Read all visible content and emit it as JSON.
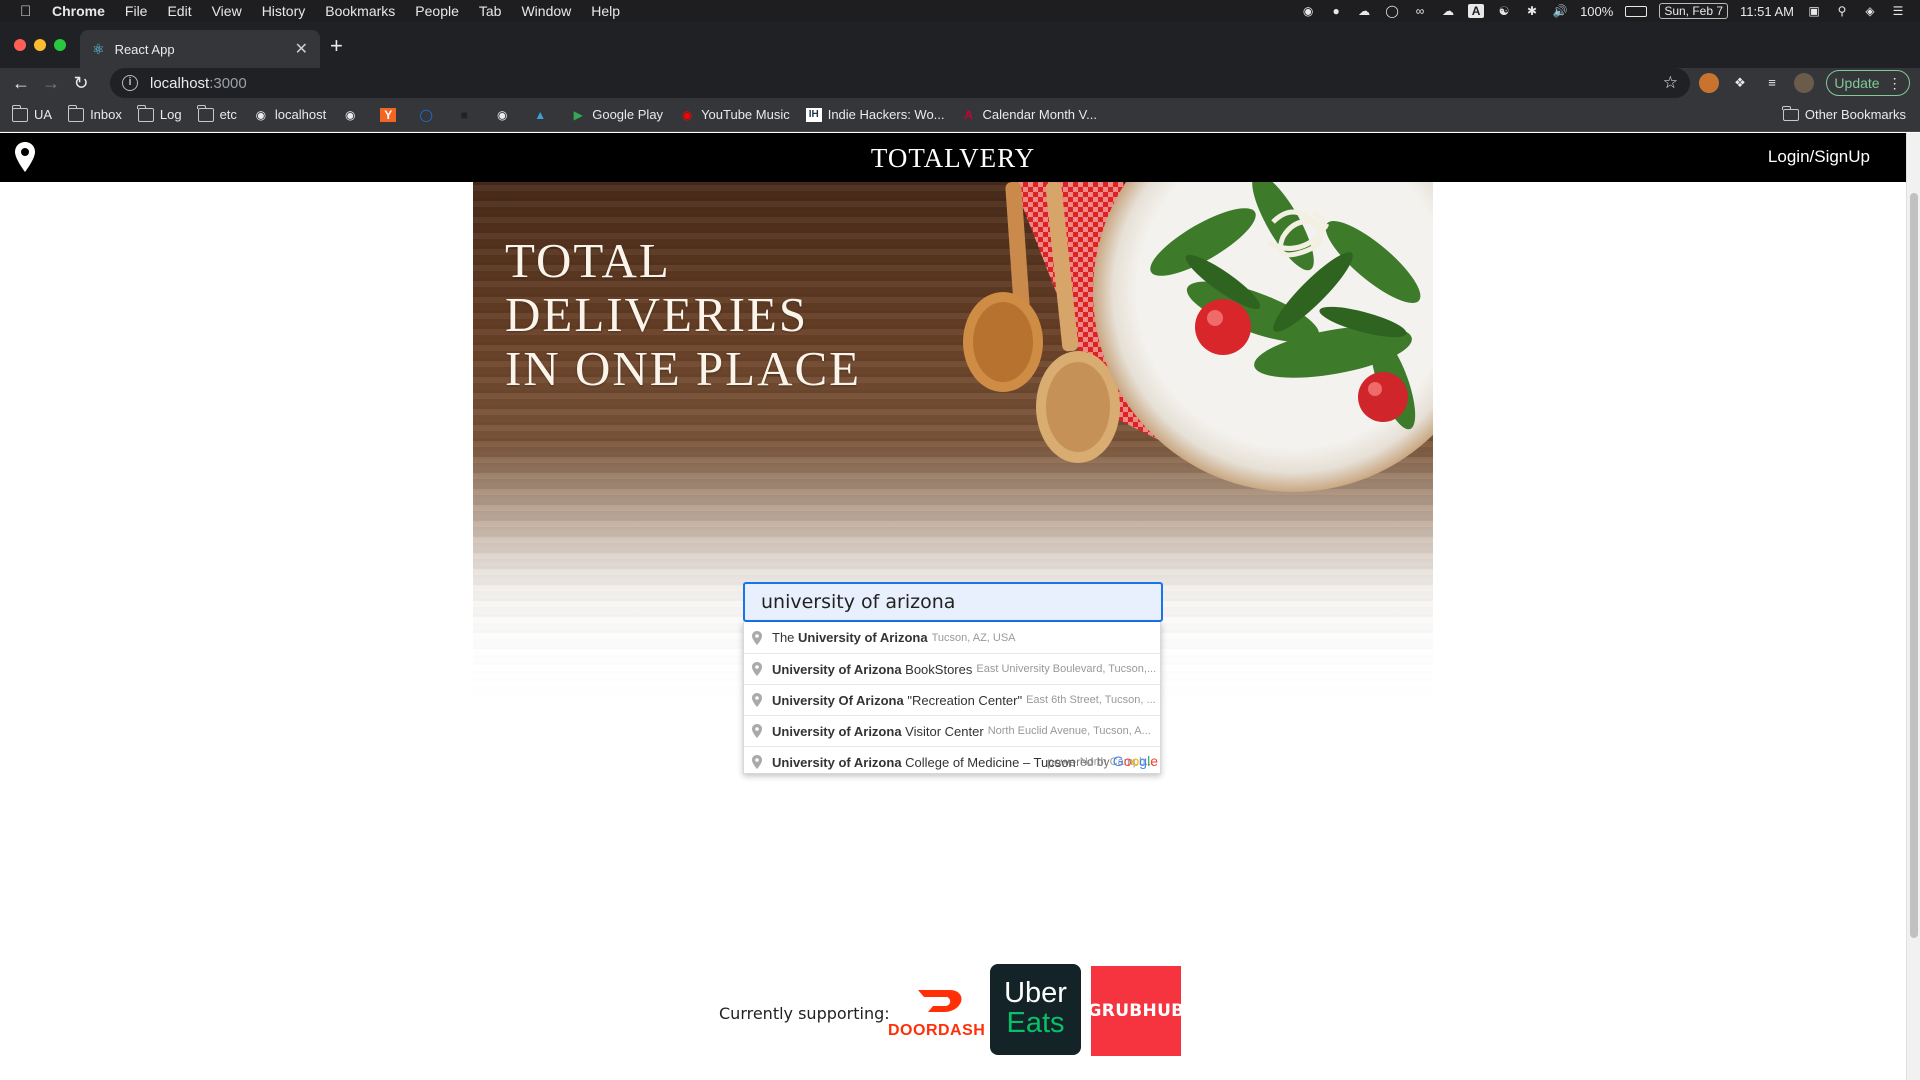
{
  "menubar": {
    "app": "Chrome",
    "items": [
      "File",
      "Edit",
      "View",
      "History",
      "Bookmarks",
      "People",
      "Tab",
      "Window",
      "Help"
    ],
    "battery": "100%",
    "date": "Sun, Feb 7",
    "time": "11:51 AM"
  },
  "tab": {
    "title": "React App"
  },
  "toolbar": {
    "url_host": "localhost",
    "url_port": ":3000",
    "update_label": "Update"
  },
  "bookmarks": {
    "items": [
      {
        "label": "UA",
        "icon": "folder-icon"
      },
      {
        "label": "Inbox",
        "icon": "folder-icon"
      },
      {
        "label": "Log",
        "icon": "folder-icon"
      },
      {
        "label": "etc",
        "icon": "folder-icon"
      },
      {
        "label": "localhost",
        "icon": "globe-icon"
      },
      {
        "label": "",
        "icon": "globe-icon"
      },
      {
        "label": "",
        "icon": "ycombinator-icon"
      },
      {
        "label": "",
        "icon": "ring-icon"
      },
      {
        "label": "",
        "icon": "hat-icon"
      },
      {
        "label": "",
        "icon": "globe-icon"
      },
      {
        "label": "",
        "icon": "fish-icon"
      },
      {
        "label": "Google Play",
        "icon": "google-play-icon"
      },
      {
        "label": "YouTube Music",
        "icon": "youtube-music-icon"
      },
      {
        "label": "Indie Hackers: Wo...",
        "icon": "indie-hackers-icon"
      },
      {
        "label": "Calendar Month V...",
        "icon": "arizona-icon"
      }
    ],
    "other": "Other Bookmarks"
  },
  "navbar": {
    "brand": "TOTALVERY",
    "login": "Login/SignUp"
  },
  "hero": {
    "title_line1": "TOTAL DELIVERIES",
    "title_line2": "IN ONE PLACE"
  },
  "search": {
    "value": "university of arizona"
  },
  "autocomplete": {
    "items": [
      {
        "prefix": "The ",
        "bold": "University of Arizona",
        "rest": "",
        "secondary": "Tucson, AZ, USA"
      },
      {
        "prefix": "",
        "bold": "University of Arizona",
        "rest": " BookStores",
        "secondary": "East University Boulevard, Tucson,..."
      },
      {
        "prefix": "",
        "bold": "University Of Arizona",
        "rest": " \"Recreation Center\"",
        "secondary": "East 6th Street, Tucson, ..."
      },
      {
        "prefix": "",
        "bold": "University of Arizona",
        "rest": " Visitor Center",
        "secondary": "North Euclid Avenue, Tucson, A..."
      },
      {
        "prefix": "",
        "bold": "University of Arizona",
        "rest": " College of Medicine – Tucson",
        "secondary": "North Campb..."
      }
    ],
    "powered_by": "powered by",
    "google": [
      "G",
      "o",
      "o",
      "g",
      "l",
      "e"
    ]
  },
  "supporting": {
    "label": "Currently supporting:",
    "doordash": "DOORDASH",
    "ubereats_line1": "Uber",
    "ubereats_line2": "Eats",
    "grubhub": "GRUBHUB"
  },
  "colors": {
    "accent_blue": "#1a73e8",
    "doordash_red": "#ff3008",
    "grubhub_red": "#f63440",
    "ubereats_green": "#06c167"
  }
}
